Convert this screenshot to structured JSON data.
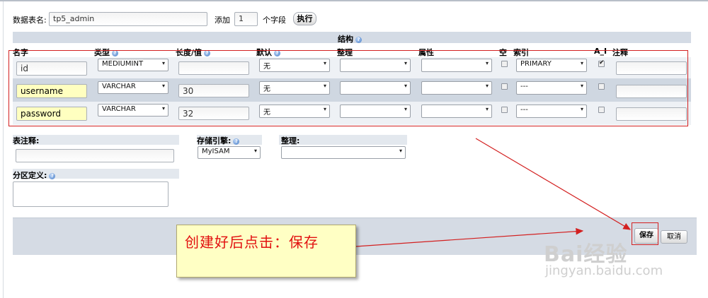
{
  "form": {
    "table_name_label": "数据表名:",
    "table_name_value": "tp5_admin",
    "add_label": "添加",
    "add_count": "1",
    "fields_label": "个字段",
    "go_button": "执行"
  },
  "structure": {
    "title": "结构",
    "columns": {
      "name": "名字",
      "type": "类型",
      "length": "长度/值",
      "default": "默认",
      "collation": "整理",
      "attributes": "属性",
      "null": "空",
      "index": "索引",
      "ai": "A_I",
      "comment": "注释"
    },
    "rows": [
      {
        "name": "id",
        "type": "MEDIUMINT",
        "length": "",
        "default": "无",
        "collation": "",
        "attributes": "",
        "null": false,
        "index": "PRIMARY",
        "ai": true,
        "comment": ""
      },
      {
        "name": "username",
        "type": "VARCHAR",
        "length": "30",
        "default": "无",
        "collation": "",
        "attributes": "",
        "null": false,
        "index": "---",
        "ai": false,
        "comment": ""
      },
      {
        "name": "password",
        "type": "VARCHAR",
        "length": "32",
        "default": "无",
        "collation": "",
        "attributes": "",
        "null": false,
        "index": "---",
        "ai": false,
        "comment": ""
      }
    ]
  },
  "table_options": {
    "comment_label": "表注释:",
    "comment_value": "",
    "engine_label": "存储引擎:",
    "engine_value": "MyISAM",
    "collation_label": "整理:",
    "collation_value": "",
    "partition_label": "分区定义:",
    "partition_value": ""
  },
  "footer": {
    "save_button": "保存",
    "cancel_button": "取消"
  },
  "annotation": {
    "text": "创建好后点击：保存"
  },
  "watermark": {
    "brand": "Bai经验",
    "url": "jingyan.baidu.com"
  },
  "colors": {
    "annotation_red": "#d32020",
    "highlight_yellow": "#ffffc0",
    "band_blue": "#d4dbe5"
  }
}
